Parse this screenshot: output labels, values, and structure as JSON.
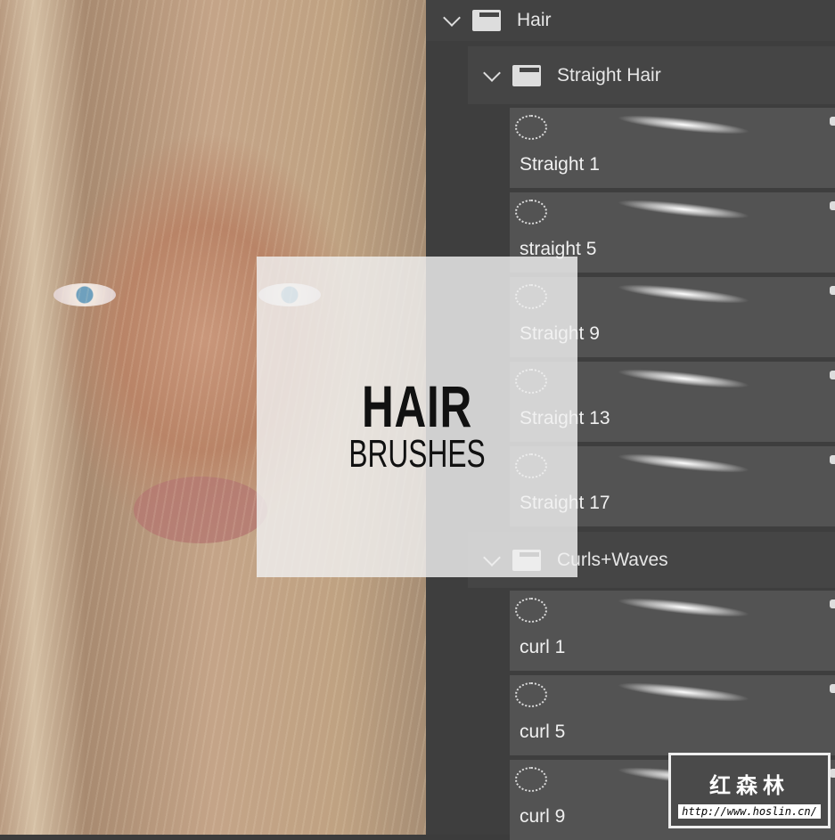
{
  "overlay": {
    "title": "HAIR",
    "subtitle": "BRUSHES"
  },
  "groups": [
    {
      "label": "Hair"
    },
    {
      "label": "Straight Hair"
    },
    {
      "label": "Curls+Waves"
    }
  ],
  "brushes": [
    {
      "label": "Straight 1"
    },
    {
      "label": "straight 5"
    },
    {
      "label": "Straight 9"
    },
    {
      "label": "Straight 13"
    },
    {
      "label": "Straight 17"
    },
    {
      "label": "curl 1"
    },
    {
      "label": "curl 5"
    },
    {
      "label": "curl 9"
    }
  ],
  "watermark": {
    "name": "红森林",
    "url": "http://www.hoslin.cn/"
  }
}
